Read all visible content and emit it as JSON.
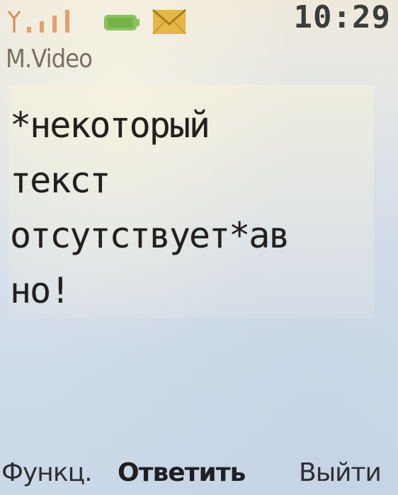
{
  "status_bar": {
    "time": "10:29",
    "icons": [
      "signal-icon",
      "battery-icon",
      "message-icon"
    ],
    "colors": {
      "signal": "#d98a52",
      "battery": "#7fbf52",
      "message": "#e0b441"
    }
  },
  "header": {
    "sender": "M.Video"
  },
  "message": {
    "body": "*некоторый\nтекст\nотсутствует*ав\nно!"
  },
  "softkeys": {
    "left": "Функц.",
    "center": "Ответить",
    "right": "Выйти"
  }
}
